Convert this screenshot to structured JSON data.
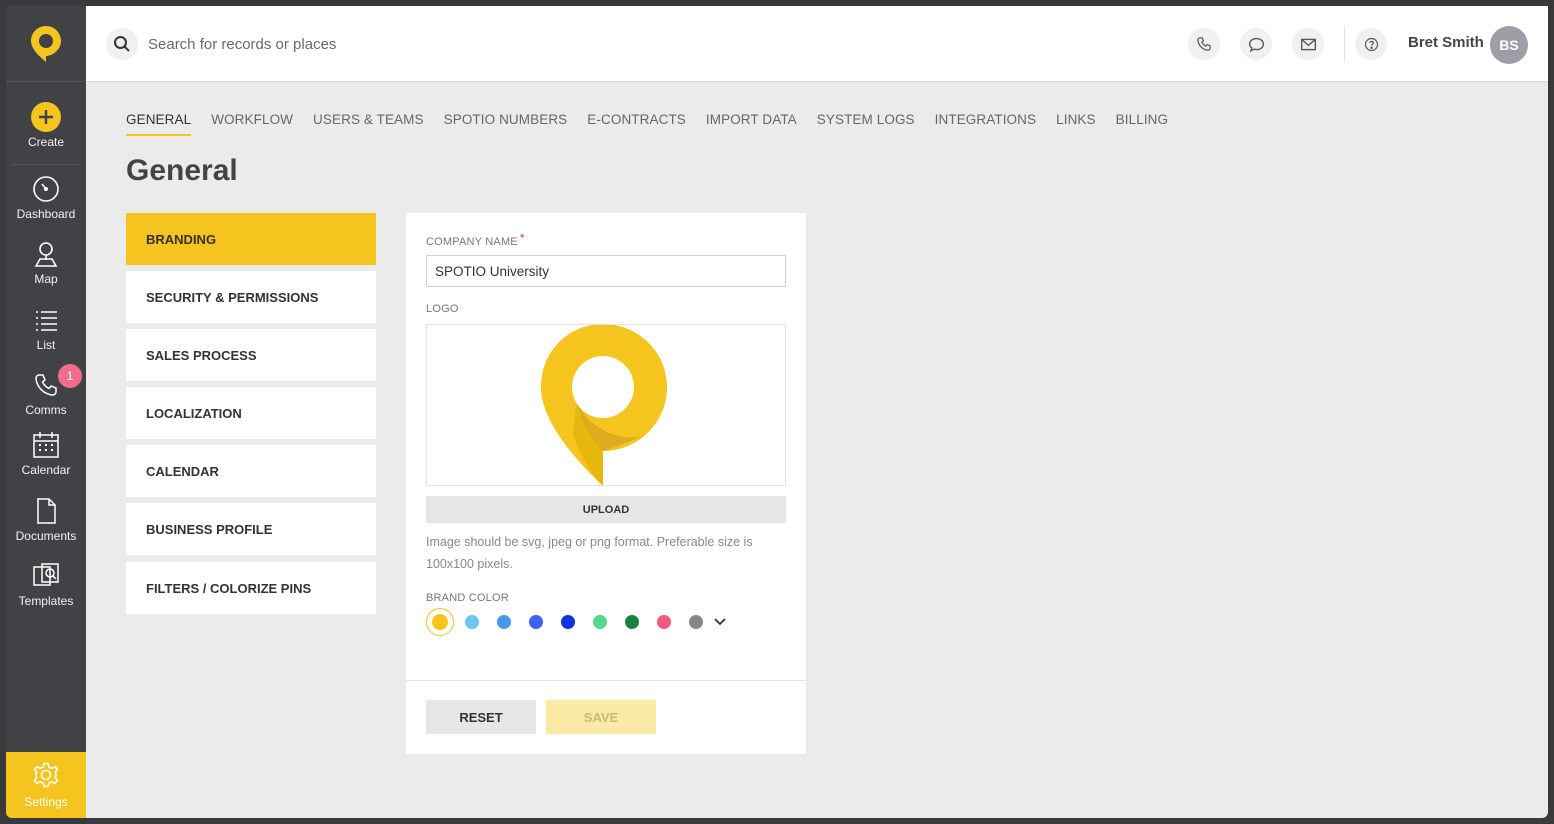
{
  "sidebar": {
    "items": [
      {
        "label": "Create",
        "icon": "plus-circle-icon"
      },
      {
        "label": "Dashboard",
        "icon": "gauge-icon"
      },
      {
        "label": "Map",
        "icon": "map-person-icon"
      },
      {
        "label": "List",
        "icon": "list-icon"
      },
      {
        "label": "Comms",
        "icon": "phone-icon",
        "badge": "1"
      },
      {
        "label": "Calendar",
        "icon": "calendar-icon"
      },
      {
        "label": "Documents",
        "icon": "document-icon"
      },
      {
        "label": "Templates",
        "icon": "templates-icon"
      }
    ],
    "settings_label": "Settings",
    "accent": "#f5c41f",
    "bg": "#414245"
  },
  "header": {
    "search_placeholder": "Search for records or places",
    "user_name": "Bret Smith",
    "user_initials": "BS"
  },
  "tabs": [
    "GENERAL",
    "WORKFLOW",
    "USERS & TEAMS",
    "SPOTIO NUMBERS",
    "E-CONTRACTS",
    "IMPORT DATA",
    "SYSTEM LOGS",
    "INTEGRATIONS",
    "LINKS",
    "BILLING"
  ],
  "active_tab": "GENERAL",
  "page_title": "General",
  "settings_menu": [
    "BRANDING",
    "SECURITY & PERMISSIONS",
    "SALES PROCESS",
    "LOCALIZATION",
    "CALENDAR",
    "BUSINESS PROFILE",
    "FILTERS / COLORIZE PINS"
  ],
  "active_setting": "BRANDING",
  "form": {
    "company_name_label": "COMPANY NAME",
    "required_mark": "*",
    "company_name_value": "SPOTIO University",
    "logo_label": "LOGO",
    "upload_label": "UPLOAD",
    "hint": "Image should be svg, jpeg or png format. Preferable size is 100x100 pixels.",
    "brand_color_label": "BRAND COLOR",
    "brand_colors": [
      "#f5c41f",
      "#6cc6f2",
      "#4a97ef",
      "#3d62f0",
      "#1133dd",
      "#55d98a",
      "#15843a",
      "#f05a80",
      "#888888"
    ],
    "selected_color": "#f5c41f",
    "reset_label": "RESET",
    "save_label": "SAVE"
  }
}
